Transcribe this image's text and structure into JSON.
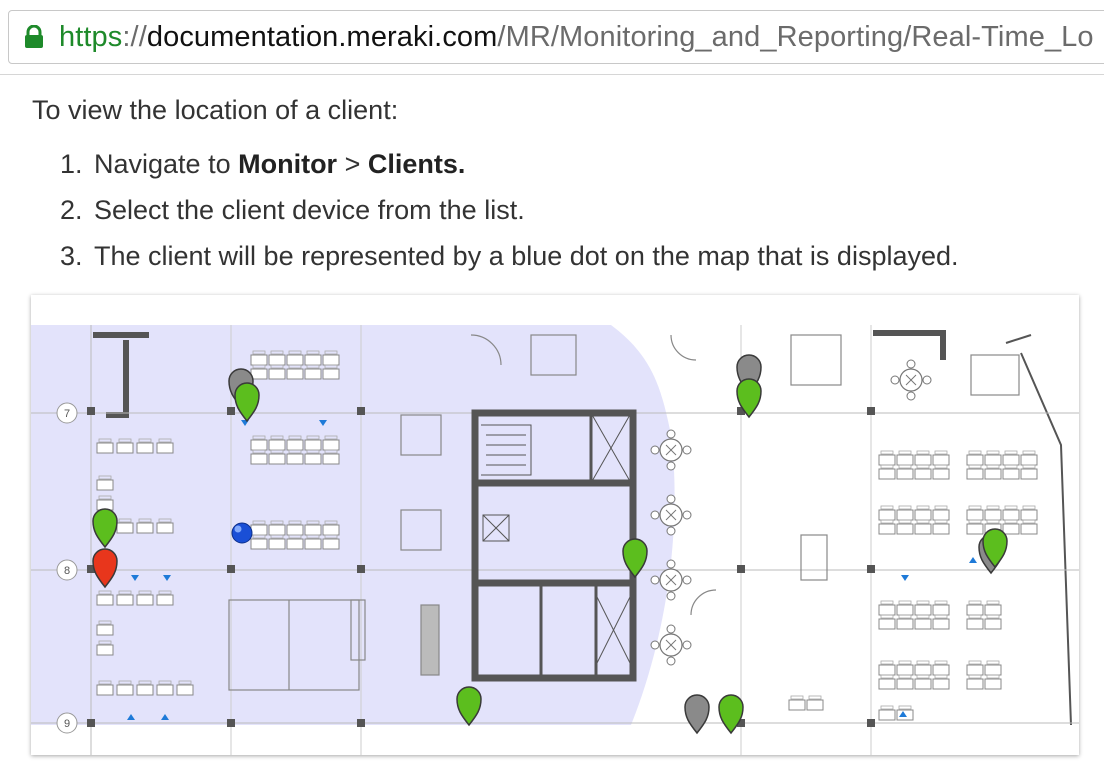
{
  "browser": {
    "url_scheme": "https",
    "url_separator": "://",
    "url_host": "documentation.meraki.com",
    "url_path": "/MR/Monitoring_and_Reporting/Real-Time_Lo",
    "lock_icon": "lock-icon",
    "colors": {
      "scheme": "#1e8a2a",
      "host": "#111111",
      "path": "#6b6b6b"
    }
  },
  "content": {
    "intro": "To view the location of a client:",
    "steps": [
      {
        "num": "1.",
        "pre": "Navigate to ",
        "bold1": "Monitor",
        "mid": " > ",
        "bold2": "Clients.",
        "post": ""
      },
      {
        "num": "2.",
        "text": "Select the client device from the list."
      },
      {
        "num": "3.",
        "text": "The client will be represented by a blue dot on the map that is displayed."
      }
    ]
  },
  "map": {
    "grid_labels": [
      "7",
      "8",
      "9"
    ],
    "colors": {
      "coverage": "#e3e3fb",
      "pin_green": "#5cbe1e",
      "pin_red": "#e8361c",
      "pin_gray": "#8a8a8a",
      "client_dot": "#1a4fd6",
      "walls": "#555555"
    }
  }
}
